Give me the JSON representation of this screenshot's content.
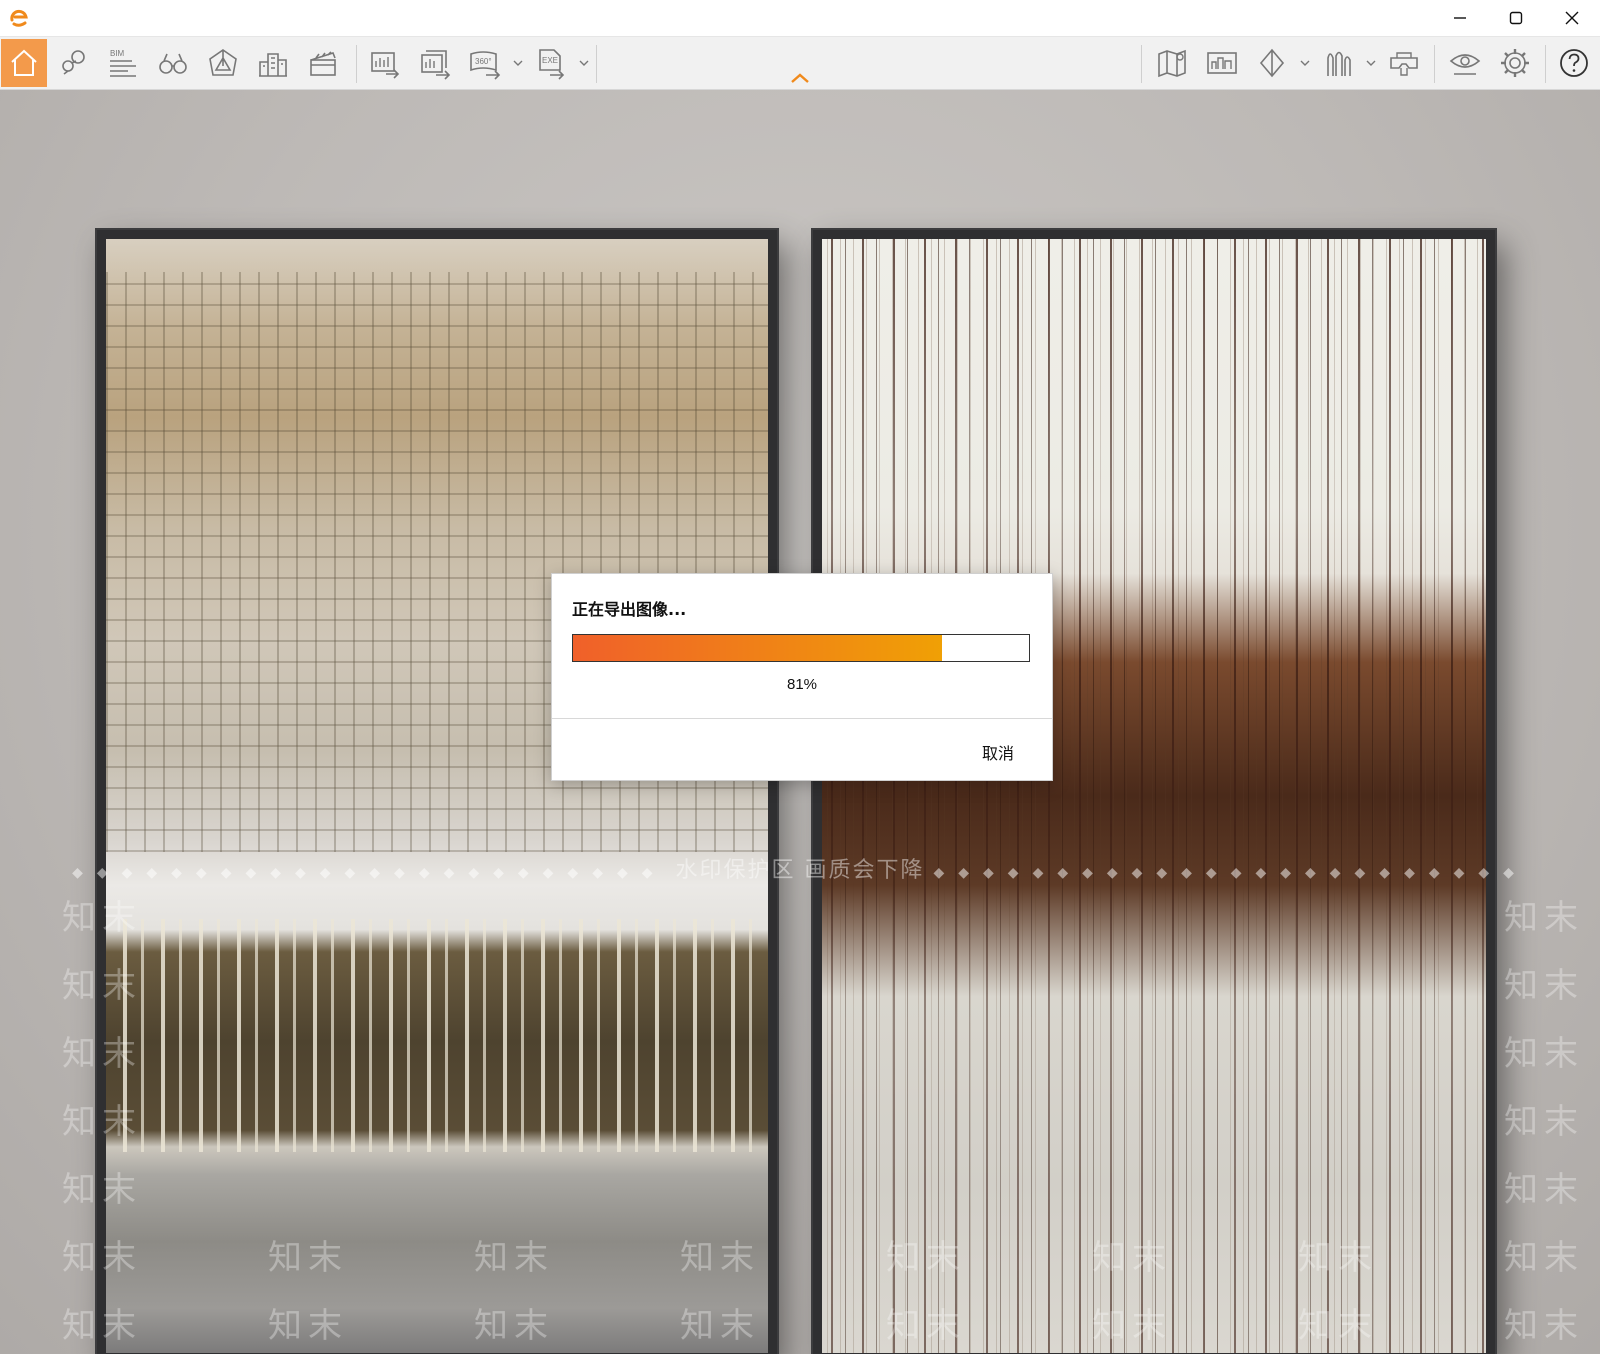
{
  "window": {
    "minimize_icon": "minimize-icon",
    "maximize_icon": "maximize-icon",
    "close_icon": "close-icon",
    "accent": "#f39a4b"
  },
  "toolbar": {
    "left_items": [
      {
        "name": "home",
        "icon": "home-icon",
        "active": true
      },
      {
        "name": "markers",
        "icon": "location-pin-icon"
      },
      {
        "name": "bim",
        "icon": "bim-icon",
        "label": "BIM"
      },
      {
        "name": "view",
        "icon": "binoculars-icon"
      },
      {
        "name": "camera-3d",
        "icon": "perspective-cube-icon"
      },
      {
        "name": "buildings",
        "icon": "buildings-icon"
      },
      {
        "name": "animation",
        "icon": "clapperboard-icon"
      },
      {
        "name": "export-image",
        "icon": "export-image-icon"
      },
      {
        "name": "export-batch",
        "icon": "export-batch-icon"
      },
      {
        "name": "export-360",
        "icon": "export-360-icon",
        "label": "360°"
      },
      {
        "name": "export-exe",
        "icon": "export-exe-icon",
        "label": "EXE"
      }
    ],
    "right_items": [
      {
        "name": "map",
        "icon": "map-icon"
      },
      {
        "name": "display",
        "icon": "display-board-icon"
      },
      {
        "name": "material",
        "icon": "material-sphere-icon"
      },
      {
        "name": "vegetation",
        "icon": "trees-icon"
      },
      {
        "name": "vr",
        "icon": "vr-headset-icon"
      },
      {
        "name": "preview",
        "icon": "eye-icon"
      },
      {
        "name": "settings",
        "icon": "gear-icon"
      },
      {
        "name": "help",
        "icon": "help-icon"
      }
    ]
  },
  "watermark": {
    "band_text": "水印保护区   画质会下降",
    "tile_text": "知末"
  },
  "dialog": {
    "title": "正在导出图像...",
    "progress": 0.81,
    "progress_label": "81%",
    "cancel_label": "取消",
    "progress_colors": [
      "#f0602a",
      "#f0a005"
    ]
  }
}
